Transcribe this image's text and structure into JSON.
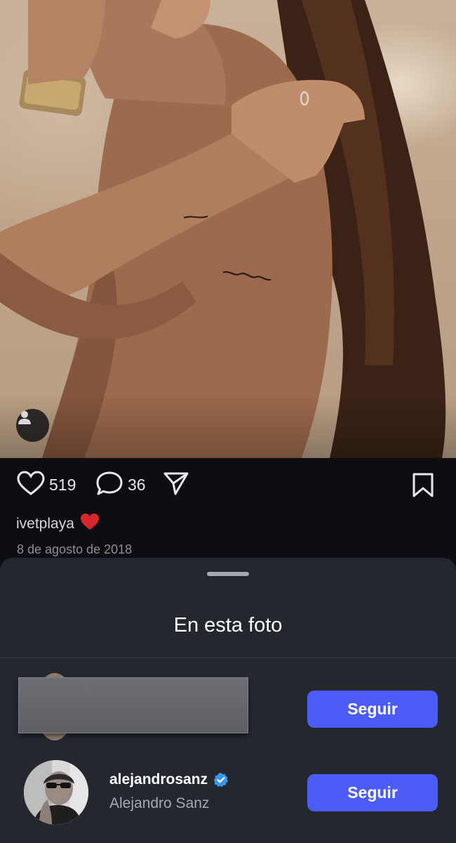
{
  "post": {
    "likes": "519",
    "comments": "36",
    "caption_user": "ivetplaya",
    "caption_emoji": "❤️",
    "date": "8 de agosto de 2018",
    "icons": [
      "person-icon",
      "heart-icon",
      "comment-icon",
      "send-icon",
      "bookmark-icon"
    ]
  },
  "sheet": {
    "title": "En esta foto",
    "users": [
      {
        "username": "",
        "fullname": "",
        "redacted": true,
        "button": "Seguir"
      },
      {
        "username": "alejandrosanz",
        "fullname": "Alejandro Sanz",
        "verified": true,
        "button": "Seguir"
      }
    ]
  },
  "colors": {
    "background": "#0d0e12",
    "sheet": "#24272e",
    "follow_button": "#4a5cf5",
    "verified_badge": "#3a97f0",
    "heart_emoji": "#d7262e"
  }
}
